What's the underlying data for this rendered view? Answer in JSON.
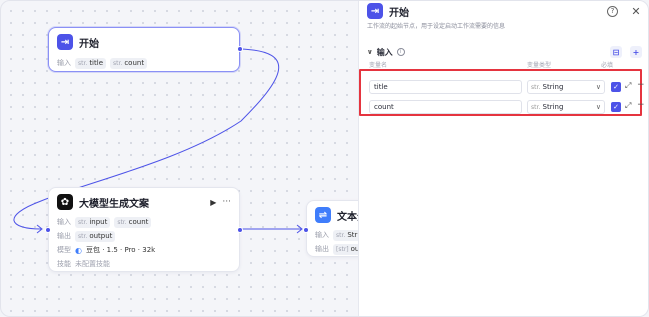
{
  "start_node": {
    "title": "开始",
    "input_label": "输入",
    "inputs": [
      {
        "type": "str.",
        "name": "title"
      },
      {
        "type": "str.",
        "name": "count"
      }
    ]
  },
  "llm_node": {
    "title": "大模型生成文案",
    "input_label": "输入",
    "inputs": [
      {
        "type": "str.",
        "name": "input"
      },
      {
        "type": "str.",
        "name": "count"
      }
    ],
    "output_label": "输出",
    "output": {
      "type": "str.",
      "name": "output"
    },
    "model_label": "模型",
    "model_value": "豆包 · 1.5 · Pro · 32k",
    "skill_label": "技能",
    "skill_value": "未配置技能"
  },
  "split_node": {
    "title": "文本分割",
    "input_label": "输入",
    "input": {
      "type": "str.",
      "name": "String"
    },
    "output_label": "输出",
    "output": {
      "type": "[str]",
      "name": "output"
    }
  },
  "panel": {
    "title": "开始",
    "description": "工作流的起始节点，用于设定启动工作流需要的信息",
    "section_title": "输入",
    "col_name": "变量名",
    "col_type": "变量类型",
    "col_required": "必填",
    "params": [
      {
        "name": "title",
        "type_prefix": "str.",
        "type": "String"
      },
      {
        "name": "count",
        "type_prefix": "str.",
        "type": "String"
      }
    ]
  },
  "colors": {
    "accent": "#4d53e8",
    "highlight": "#e5343f",
    "edge": "#4d53e8"
  }
}
